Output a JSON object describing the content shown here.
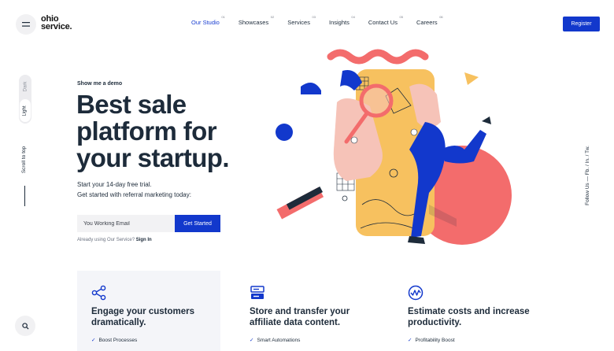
{
  "header": {
    "logo_line1": "ohio",
    "logo_line2": "service.",
    "nav": [
      {
        "label": "Our Studio",
        "num": "01"
      },
      {
        "label": "Showcases",
        "num": "02"
      },
      {
        "label": "Services",
        "num": "03"
      },
      {
        "label": "Insights",
        "num": "04"
      },
      {
        "label": "Contact Us",
        "num": "05"
      },
      {
        "label": "Careers",
        "num": "06"
      }
    ],
    "register_label": "Register"
  },
  "sidebar": {
    "dark_label": "Dark",
    "light_label": "Light",
    "scroll_label": "Scroll to top"
  },
  "social": {
    "label": "Follow Us  —  Fb.  /  In.  /  Tw."
  },
  "hero": {
    "kicker": "Show me a demo",
    "title_line1": "Best sale",
    "title_line2": "platform for",
    "title_line3": "your startup.",
    "sub_line1": "Start your 14-day free trial.",
    "sub_line2": "Get started with referral marketing today:",
    "email_placeholder": "You Working Email",
    "cta_label": "Get Started",
    "already_text": "Already using Our Service?",
    "signin_label": "Sign In"
  },
  "features": [
    {
      "icon": "share-nodes-icon",
      "title": "Engage your customers dramatically.",
      "check": "Boost Processes"
    },
    {
      "icon": "server-icon",
      "title": "Store and transfer your affiliate data content.",
      "check": "Smart Automations"
    },
    {
      "icon": "pulse-wave-icon",
      "title": "Estimate costs and increase productivity.",
      "check": "Profitability Boost"
    }
  ],
  "colors": {
    "accent": "#1238cc",
    "text": "#1d2b3a",
    "coral": "#f36c6c",
    "yellow": "#f7c15f",
    "pink": "#f6c3b8"
  }
}
